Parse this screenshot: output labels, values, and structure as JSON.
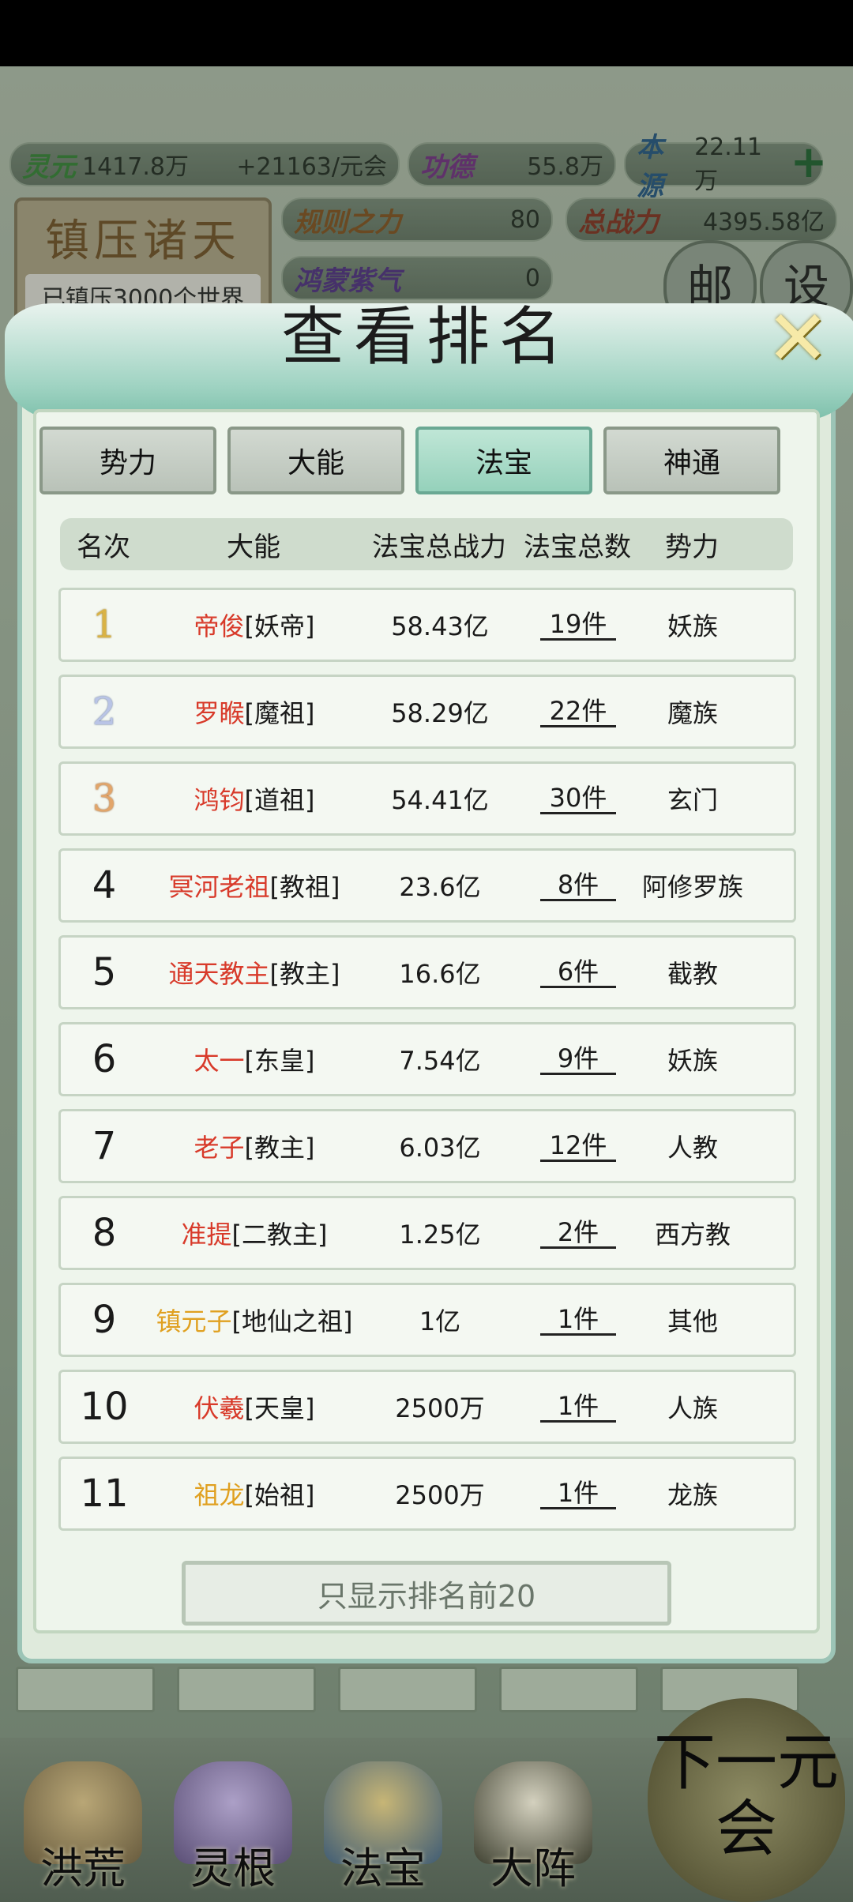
{
  "resources": {
    "lingyuan_label": "灵元",
    "lingyuan_value": "1417.8万",
    "lingyuan_rate": "+21163/元会",
    "gongde_label": "功德",
    "gongde_value": "55.8万",
    "benyuan_label": "本源",
    "benyuan_value": "22.11万",
    "guize_label": "规则之力",
    "guize_value": "80",
    "zongzhanli_label": "总战力",
    "zongzhanli_value": "4395.58亿",
    "hongmeng_label": "鸿蒙紫气",
    "hongmeng_value": "0"
  },
  "zhenya": {
    "title": "镇压诸天",
    "subtitle": "已镇压3000个世界"
  },
  "round_buttons": {
    "mail": "邮",
    "settings": "设"
  },
  "dialog": {
    "title": "查看排名",
    "close_icon": "close-icon",
    "tabs": [
      "势力",
      "大能",
      "法宝",
      "神通"
    ],
    "active_tab": "法宝",
    "headers": {
      "rank": "名次",
      "name": "大能",
      "power": "法宝总战力",
      "count": "法宝总数",
      "faction": "势力"
    },
    "rows": [
      {
        "rank": "1",
        "name": "帝俊",
        "title": "[妖帝]",
        "power": "58.43亿",
        "count": "19件",
        "faction": "妖族"
      },
      {
        "rank": "2",
        "name": "罗睺",
        "title": "[魔祖]",
        "power": "58.29亿",
        "count": "22件",
        "faction": "魔族"
      },
      {
        "rank": "3",
        "name": "鸿钧",
        "title": "[道祖]",
        "power": "54.41亿",
        "count": "30件",
        "faction": "玄门"
      },
      {
        "rank": "4",
        "name": "冥河老祖",
        "title": "[教祖]",
        "power": "23.6亿",
        "count": "8件",
        "faction": "阿修罗族"
      },
      {
        "rank": "5",
        "name": "通天教主",
        "title": "[教主]",
        "power": "16.6亿",
        "count": "6件",
        "faction": "截教"
      },
      {
        "rank": "6",
        "name": "太一",
        "title": "[东皇]",
        "power": "7.54亿",
        "count": "9件",
        "faction": "妖族"
      },
      {
        "rank": "7",
        "name": "老子",
        "title": "[教主]",
        "power": "6.03亿",
        "count": "12件",
        "faction": "人教"
      },
      {
        "rank": "8",
        "name": "准提",
        "title": "[二教主]",
        "power": "1.25亿",
        "count": "2件",
        "faction": "西方教"
      },
      {
        "rank": "9",
        "name": "镇元子",
        "title": "[地仙之祖]",
        "power": "1亿",
        "count": "1件",
        "faction": "其他"
      },
      {
        "rank": "10",
        "name": "伏羲",
        "title": "[天皇]",
        "power": "2500万",
        "count": "1件",
        "faction": "人族"
      },
      {
        "rank": "11",
        "name": "祖龙",
        "title": "[始祖]",
        "power": "2500万",
        "count": "1件",
        "faction": "龙族"
      }
    ],
    "only_top_button": "只显示排名前20"
  },
  "bottom_nav": [
    "洪荒",
    "灵根",
    "法宝",
    "大阵"
  ],
  "next_era": "下一元会"
}
